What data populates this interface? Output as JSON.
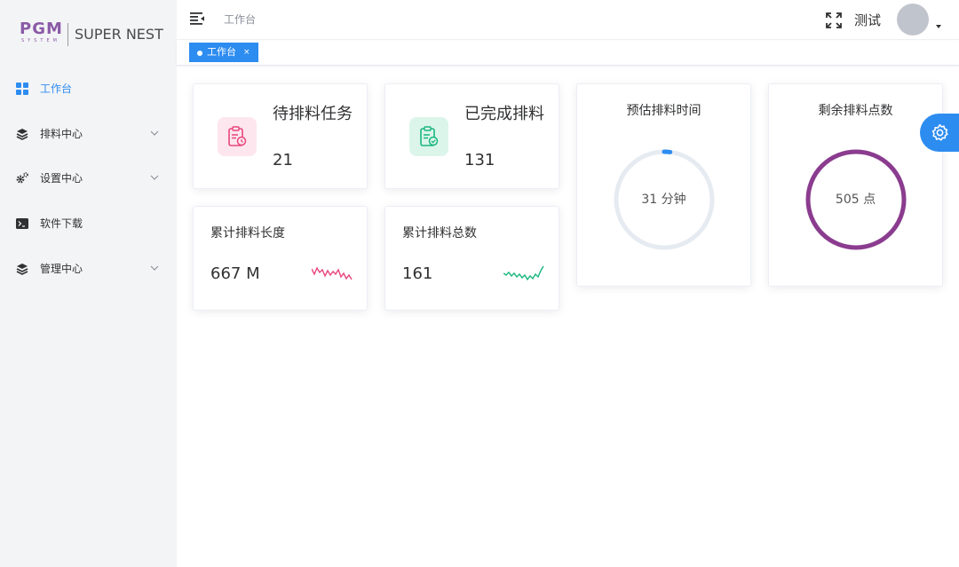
{
  "brand": {
    "logo_mark": "PGM",
    "logo_sub": "SYSTEM",
    "name": "SUPER NEST"
  },
  "sidebar": {
    "items": [
      {
        "label": "工作台",
        "icon": "dashboard-icon",
        "active": true
      },
      {
        "label": "排料中心",
        "icon": "layers-icon",
        "expandable": true
      },
      {
        "label": "设置中心",
        "icon": "cogs-icon",
        "expandable": true
      },
      {
        "label": "软件下载",
        "icon": "terminal-icon"
      },
      {
        "label": "管理中心",
        "icon": "layers-icon",
        "expandable": true
      }
    ]
  },
  "header": {
    "breadcrumb": "工作台",
    "username": "测试"
  },
  "tabs": [
    {
      "label": "工作台",
      "close": "×",
      "active": true
    }
  ],
  "stats": {
    "pending": {
      "title": "待排料任务",
      "value": "21",
      "icon": "clipboard-clock-icon",
      "color": "#e8467c",
      "bg": "#fde6ee"
    },
    "done": {
      "title": "已完成排料",
      "value": "131",
      "icon": "clipboard-check-icon",
      "color": "#19b77e",
      "bg": "#dcf5eb"
    },
    "total_length": {
      "title": "累计排料长度",
      "value": "667 M",
      "spark_color": "#e8467c"
    },
    "total_count": {
      "title": "累计排料总数",
      "value": "161",
      "spark_color": "#19b77e"
    }
  },
  "rings": {
    "time": {
      "title": "预估排料时间",
      "value": "31 分钟",
      "color": "#2d8cf0",
      "track": "#e6ebf2",
      "progress": 0.02
    },
    "points": {
      "title": "剩余排料点数",
      "value": "505 点",
      "color": "#8b3c8f",
      "track": "#e6ebf2",
      "progress": 1.0
    }
  },
  "colors": {
    "accent": "#2d8cf0",
    "sidebar_bg": "#f3f4f6"
  }
}
